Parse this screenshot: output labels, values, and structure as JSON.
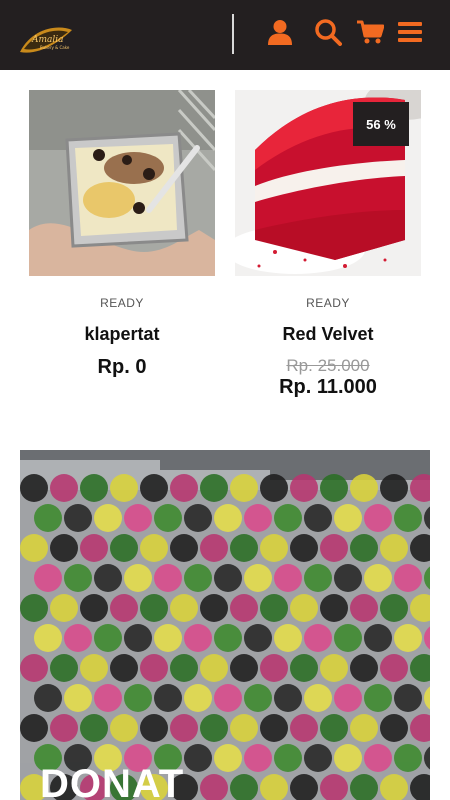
{
  "header": {
    "logo_text": "Amalia Bakery & Cake",
    "icons": [
      "user-icon",
      "search-icon",
      "cart-icon",
      "menu-icon"
    ],
    "accent_color": "#f26a21",
    "background_color": "#231f20"
  },
  "products": [
    {
      "status": "READY",
      "name": "klapertat",
      "price": "Rp. 0"
    },
    {
      "status": "READY",
      "name": "Red Velvet",
      "old_price": "Rp. 25.000",
      "price": "Rp. 11.000",
      "discount_badge": "56 %"
    }
  ],
  "banner": {
    "title": "DONAT"
  }
}
